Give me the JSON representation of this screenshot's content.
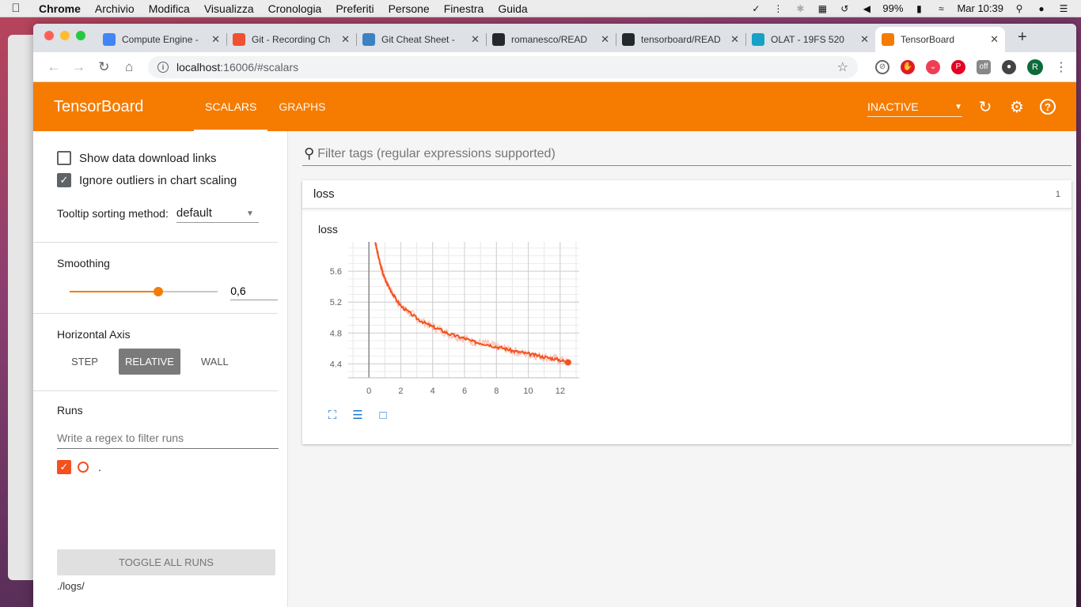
{
  "os_menubar": {
    "app": "Chrome",
    "menus": [
      "Archivio",
      "Modifica",
      "Visualizza",
      "Cronologia",
      "Preferiti",
      "Persone",
      "Finestra",
      "Guida"
    ],
    "battery": "99%",
    "clock": "Mar 10:39"
  },
  "browser": {
    "tabs": [
      {
        "title": "Compute Engine -",
        "icon": "gcp-icon",
        "color": "#4285f4"
      },
      {
        "title": "Git - Recording Ch",
        "icon": "git-icon",
        "color": "#f05133"
      },
      {
        "title": "Git Cheat Sheet -",
        "icon": "git-cheat-icon",
        "color": "#3b82c4"
      },
      {
        "title": "romanesco/READ",
        "icon": "github-icon",
        "color": "#24292e"
      },
      {
        "title": "tensorboard/READ",
        "icon": "github-icon",
        "color": "#24292e"
      },
      {
        "title": "OLAT - 19FS 520",
        "icon": "olat-icon",
        "color": "#16a1c7"
      },
      {
        "title": "TensorBoard",
        "icon": "tensorboard-icon",
        "color": "#f57c00"
      }
    ],
    "url_host": "localhost",
    "url_path": ":16006/#scalars"
  },
  "tensorboard": {
    "title": "TensorBoard",
    "tabs": [
      "SCALARS",
      "GRAPHS"
    ],
    "status_select": "INACTIVE",
    "accent": "#f57c00"
  },
  "sidebar": {
    "show_download_links": "Show data download links",
    "ignore_outliers": "Ignore outliers in chart scaling",
    "tooltip_label": "Tooltip sorting method:",
    "tooltip_value": "default",
    "smoothing_label": "Smoothing",
    "smoothing_value": "0,6",
    "smoothing_fraction": 0.6,
    "axis_label": "Horizontal Axis",
    "axis_options": [
      "STEP",
      "RELATIVE",
      "WALL"
    ],
    "axis_selected": "RELATIVE",
    "runs_label": "Runs",
    "runs_filter_placeholder": "Write a regex to filter runs",
    "run_name": ".",
    "toggle_all": "TOGGLE ALL RUNS",
    "logdir": "./logs/"
  },
  "main": {
    "filter_placeholder": "Filter tags (regular expressions supported)",
    "card_title": "loss",
    "card_count": "1",
    "chart_title": "loss"
  },
  "chart_data": {
    "type": "line",
    "title": "loss",
    "xlabel": "",
    "ylabel": "",
    "x_ticks": [
      0,
      2,
      4,
      6,
      8,
      10,
      12
    ],
    "y_ticks": [
      4.4,
      4.8,
      5.2,
      5.6
    ],
    "xlim": [
      -1.3,
      13.2
    ],
    "ylim": [
      4.22,
      5.98
    ],
    "series": [
      {
        "color": "#f4511e",
        "x": [
          0.4,
          0.6,
          0.8,
          1.0,
          1.3,
          1.6,
          2.0,
          2.5,
          3.0,
          3.5,
          4.0,
          4.5,
          5.0,
          5.5,
          6.0,
          6.5,
          7.0,
          7.5,
          8.0,
          8.5,
          9.0,
          9.5,
          10.0,
          10.5,
          11.0,
          11.5,
          12.0,
          12.5
        ],
        "y": [
          5.98,
          5.78,
          5.62,
          5.5,
          5.38,
          5.27,
          5.15,
          5.07,
          4.99,
          4.93,
          4.88,
          4.84,
          4.79,
          4.76,
          4.73,
          4.69,
          4.67,
          4.65,
          4.62,
          4.6,
          4.57,
          4.55,
          4.53,
          4.51,
          4.49,
          4.47,
          4.45,
          4.42
        ]
      }
    ],
    "grid": true
  }
}
